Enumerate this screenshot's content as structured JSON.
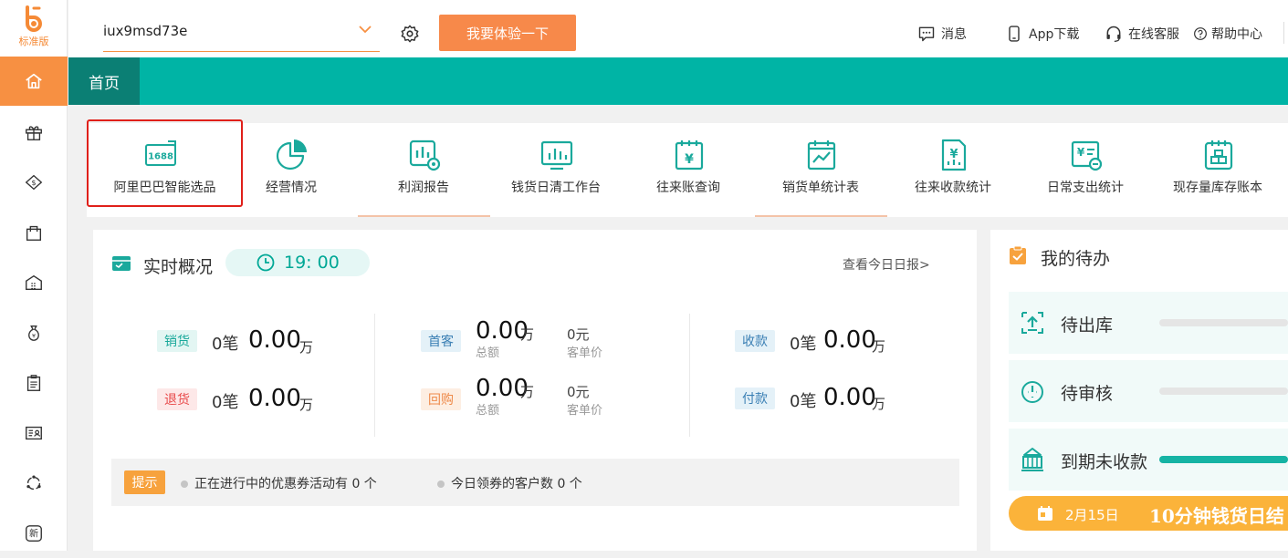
{
  "logo": {
    "edition": "标准版"
  },
  "sidebar": {
    "items": [
      {
        "icon": "home-icon"
      },
      {
        "icon": "gift-icon"
      },
      {
        "icon": "money-house-icon"
      },
      {
        "icon": "shopping-bag-icon"
      },
      {
        "icon": "warehouse-icon"
      },
      {
        "icon": "money-bag-icon"
      },
      {
        "icon": "clipboard-icon"
      },
      {
        "icon": "id-card-icon"
      },
      {
        "icon": "network-icon"
      },
      {
        "icon": "new-badge-icon",
        "label": "新"
      }
    ]
  },
  "topbar": {
    "account": "iux9msd73e",
    "try_button": "我要体验一下",
    "links": {
      "message": "消息",
      "app": "App下载",
      "service": "在线客服",
      "help": "帮助中心"
    }
  },
  "tabs": {
    "home": "首页"
  },
  "quicknav": [
    {
      "label": "阿里巴巴智能选品",
      "icon": "1688-icon",
      "badge": "1688"
    },
    {
      "label": "经营情况",
      "icon": "pie-chart-icon"
    },
    {
      "label": "利润报告",
      "icon": "profit-report-icon"
    },
    {
      "label": "钱货日清工作台",
      "icon": "bar-chart-icon"
    },
    {
      "label": "往来账查询",
      "icon": "yuan-calendar-icon"
    },
    {
      "label": "销货单统计表",
      "icon": "trend-calendar-icon"
    },
    {
      "label": "往来收款统计",
      "icon": "yuan-doc-icon"
    },
    {
      "label": "日常支出统计",
      "icon": "expense-icon"
    },
    {
      "label": "现存量库存账本",
      "icon": "inventory-icon"
    }
  ],
  "realtime": {
    "title": "实时概况",
    "time": "19: 00",
    "report_link": "查看今日日报>",
    "sales": {
      "tag": "销货",
      "count": "0笔",
      "amount": "0.00",
      "unit": "万"
    },
    "returns": {
      "tag": "退货",
      "count": "0笔",
      "amount": "0.00",
      "unit": "万"
    },
    "first_purchase": {
      "tag": "首客",
      "amount": "0.00",
      "unit": "万",
      "total_label": "总额",
      "avg": "0元",
      "avg_label": "客单价"
    },
    "repurchase": {
      "tag": "回购",
      "amount": "0.00",
      "unit": "万",
      "total_label": "总额",
      "avg": "0元",
      "avg_label": "客单价"
    },
    "receipts": {
      "tag": "收款",
      "count": "0笔",
      "amount": "0.00",
      "unit": "万"
    },
    "payments": {
      "tag": "付款",
      "count": "0笔",
      "amount": "0.00",
      "unit": "万"
    },
    "tip": {
      "tag": "提示",
      "coupon_activity": "正在进行中的优惠券活动有 0 个",
      "coupon_customers": "今日领券的客户数 0 个"
    }
  },
  "todo": {
    "title": "我的待办",
    "items": [
      {
        "label": "待出库",
        "progress": 0
      },
      {
        "label": "待审核",
        "progress": 0
      },
      {
        "label": "到期未收款",
        "progress": 1.0
      }
    ],
    "banner": {
      "date": "2月15日",
      "slogan": "10分钟钱货日结"
    }
  },
  "colors": {
    "accent_orange": "#f79042",
    "teal": "#00b4a5",
    "teal_dark": "#0b7f74",
    "selection_red": "#e0201a"
  }
}
